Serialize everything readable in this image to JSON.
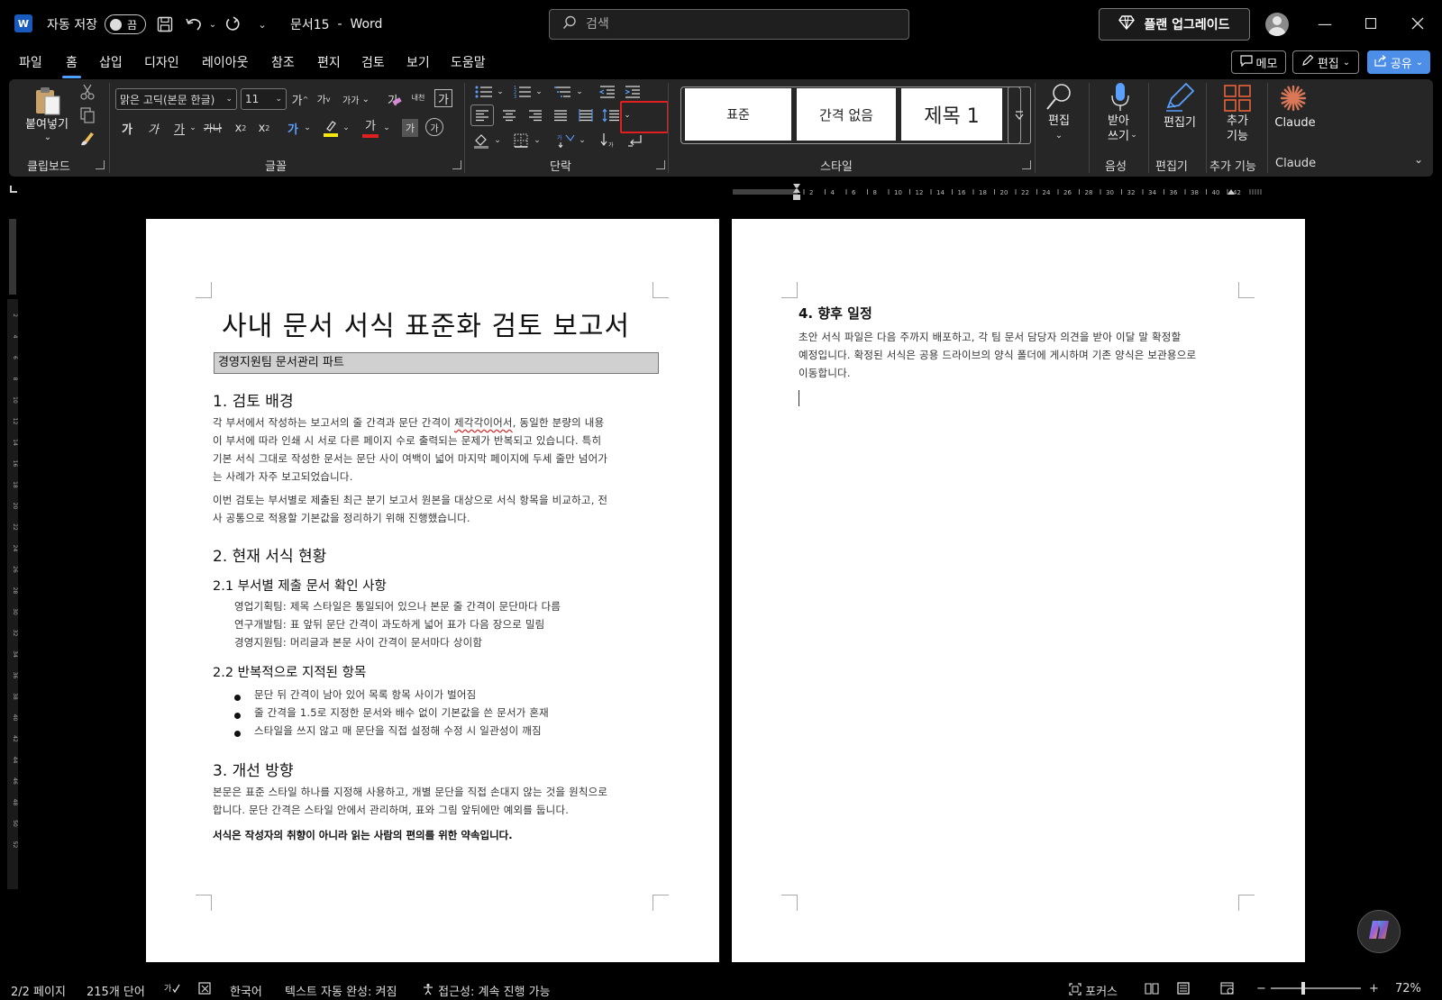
{
  "titlebar": {
    "app_logo": "W",
    "autosave_label": "자동 저장",
    "autosave_state": "끔",
    "doc_title": "문서15",
    "app_separator": "-",
    "app_name": "Word",
    "search_placeholder": "검색",
    "upgrade_label": "플랜 업그레이드",
    "icons": [
      "save-icon",
      "undo-icon",
      "redo-icon",
      "customize-icon",
      "search-icon",
      "diamond-icon",
      "account-icon",
      "minimize-icon",
      "maximize-icon",
      "close-icon"
    ]
  },
  "menu": {
    "tabs": [
      "파일",
      "홈",
      "삽입",
      "디자인",
      "레이아웃",
      "참조",
      "편지",
      "검토",
      "보기",
      "도움말"
    ],
    "active": "홈",
    "memo_label": "메모",
    "edit_label": "편집",
    "share_label": "공유"
  },
  "ribbon": {
    "clipboard": {
      "label": "클립보드",
      "paste_label": "붙여넣기"
    },
    "font": {
      "label": "글꼴",
      "font_name": "맑은 고딕(본문 한글)",
      "font_size": "11",
      "grow": "가",
      "shrink": "가",
      "change_case": "가가",
      "clear_format": "가",
      "phonetic": "내천",
      "char_border": "가",
      "bold": "가",
      "italic": "가",
      "underline": "가",
      "strike": "가나",
      "subscript": "x",
      "subscript_mark": "2",
      "superscript": "x",
      "superscript_mark": "2",
      "text_effects": "가",
      "font_color": "가",
      "char_shade": "가",
      "enclose": "가",
      "highlight_color": "#f5e60c",
      "font_color_value": "#e02020"
    },
    "paragraph": {
      "label": "단락"
    },
    "styles": {
      "label": "스타일",
      "items": [
        "표준",
        "간격 없음",
        "제목 1"
      ]
    },
    "editing": {
      "label": "편집",
      "group_label": ""
    },
    "voice": {
      "label": "받아\n쓰기",
      "group_label": "음성"
    },
    "editor": {
      "label": "편집기",
      "group_label": "편집기"
    },
    "addins": {
      "label": "추가\n기능",
      "group_label": "추가 기능"
    },
    "claude": {
      "label": "Claude",
      "group_label": "Claude",
      "color": "#d97757"
    }
  },
  "ruler": {
    "ticks": [
      "2",
      "4",
      "6",
      "8",
      "10",
      "12",
      "14",
      "16",
      "18",
      "20",
      "22",
      "24",
      "26",
      "28",
      "30",
      "32",
      "34",
      "36",
      "38",
      "40",
      "42"
    ],
    "vticks": [
      "2",
      "4",
      "6",
      "8",
      "10",
      "12",
      "14",
      "16",
      "18",
      "20",
      "22",
      "24",
      "26",
      "28",
      "30",
      "32",
      "34",
      "36",
      "38",
      "40",
      "42",
      "44",
      "46",
      "48",
      "50",
      "52"
    ]
  },
  "page1": {
    "title": "사내 문서 서식 표준화 검토 보고서",
    "subtitle": "경영지원팀 문서관리 파트",
    "h1_background": "1. 검토 배경",
    "bg_p1_lines": [
      [
        "각 부서에서 작성하는 보고서의 줄 간격과 문단 간격이 ",
        "제각각이어서",
        ", 동일한 분량의 내용"
      ],
      [
        "이 부서에 따라 인쇄 시 서로 다른 페이지 수로 출력되는 문제가 반복되고 있습니다. 특히"
      ],
      [
        "기본 서식 그대로 작성한 문서는 문단 사이 여백이 넓어 마지막 페이지에 두세 줄만 넘어가"
      ],
      [
        "는 사례가 자주 보고되었습니다."
      ]
    ],
    "bg_p2_lines": [
      "이번 검토는 부서별로 제출된 최근 분기 보고서 원본을 대상으로 서식 항목을 비교하고, 전",
      "사 공통으로 적용할 기본값을 정리하기 위해 진행했습니다."
    ],
    "h1_status": "2. 현재 서식 현황",
    "h2_depts": "2.1 부서별 제출 문서 확인 사항",
    "dept_items": [
      "영업기획팀: 제목 스타일은 통일되어 있으나 본문 줄 간격이 문단마다 다름",
      "연구개발팀: 표 앞뒤 문단 간격이 과도하게 넓어 표가 다음 장으로 밀림",
      "경영지원팀: 머리글과 본문 사이 간격이 문서마다 상이함"
    ],
    "h2_repeat": "2.2 반복적으로 지적된 항목",
    "bullets": [
      "문단 뒤 간격이 남아 있어 목록 항목 사이가 벌어짐",
      "줄 간격을 1.5로 지정한 문서와 배수 없이 기본값을 쓴 문서가 혼재",
      "스타일을 쓰지 않고 매 문단을 직접 설정해 수정 시 일관성이 깨짐"
    ],
    "h1_improve": "3. 개선 방향",
    "improve_lines": [
      "본문은 표준 스타일 하나를 지정해 사용하고, 개별 문단을 직접 손대지 않는 것을 원칙으로",
      "합니다. 문단 간격은 스타일 안에서 관리하며, 표와 그림 앞뒤에만 예외를 둡니다."
    ],
    "closing": "서식은 작성자의 취향이 아니라 읽는 사람의 편의를 위한 약속입니다."
  },
  "page2": {
    "h1_schedule": "4. 향후 일정",
    "schedule_lines": [
      "초안 서식 파일은 다음 주까지 배포하고, 각 팀 문서 담당자 의견을 받아 이달 말 확정할",
      "예정입니다. 확정된 서식은 공용 드라이브의 양식 폴더에 게시하며 기존 양식은 보관용으로",
      "이동합니다."
    ]
  },
  "status": {
    "page": "2/2 페이지",
    "words": "215개 단어",
    "language": "한국어",
    "autocomplete": "텍스트 자동 완성: 켜짐",
    "accessibility": "접근성: 계속 진행 가능",
    "focus": "포커스",
    "zoom": "72%"
  }
}
